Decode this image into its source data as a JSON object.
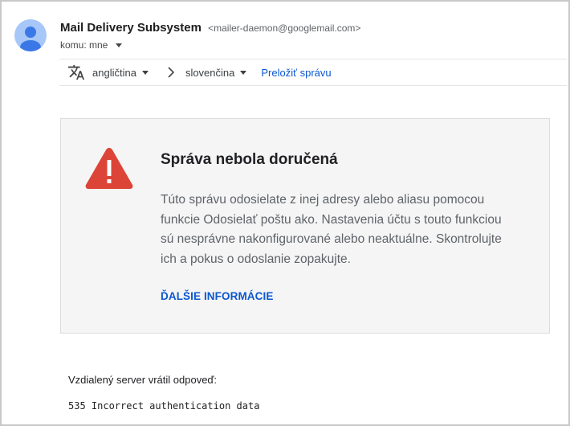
{
  "header": {
    "sender_name": "Mail Delivery Subsystem",
    "sender_email": "<mailer-daemon@googlemail.com>",
    "to_label": "komu: mne"
  },
  "translate_bar": {
    "source_language": "angličtina",
    "target_language": "slovenčina",
    "translate_link": "Preložiť správu"
  },
  "card": {
    "title": "Správa nebola doručená",
    "body_lines": [
      "Túto správu odosielate z inej adresy alebo aliasu pomocou",
      "funkcie Odosielať poštu ako. Nastavenia účtu s touto funkciou",
      "sú nesprávne nakonfigurované alebo neaktuálne. Skontrolujte",
      "ich a pokus o odoslanie zopakujte."
    ],
    "more_info_link": "ĎALŠIE INFORMÁCIE",
    "icon": "warning-triangle-icon",
    "icon_color": "#db4437"
  },
  "footer": {
    "remote_server_label": "Vzdialený server vrátil odpoveď:",
    "server_response": "535 Incorrect authentication data"
  },
  "colors": {
    "link": "#0b57d0",
    "avatar_bg": "#a7c7f9",
    "avatar_fg": "#4285f4"
  }
}
